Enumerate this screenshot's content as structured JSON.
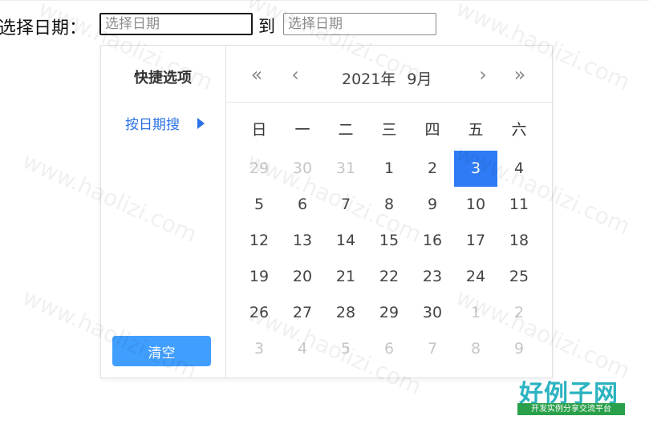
{
  "form": {
    "label": "选择日期：",
    "start_placeholder": "选择日期",
    "end_placeholder": "选择日期",
    "range_separator": "到"
  },
  "sidebar": {
    "title": "快捷选项",
    "shortcut": "按日期搜",
    "clear_button": "清空"
  },
  "calendar": {
    "year_label": "2021年",
    "month_label": "9月",
    "nav": {
      "prev_year": "«",
      "prev_month": "‹",
      "next_month": "›",
      "next_year": "»"
    },
    "weekdays": [
      "日",
      "一",
      "二",
      "三",
      "四",
      "五",
      "六"
    ],
    "days": [
      {
        "label": "29",
        "other": true
      },
      {
        "label": "30",
        "other": true
      },
      {
        "label": "31",
        "other": true
      },
      {
        "label": "1"
      },
      {
        "label": "2"
      },
      {
        "label": "3",
        "selected": true
      },
      {
        "label": "4"
      },
      {
        "label": "5"
      },
      {
        "label": "6"
      },
      {
        "label": "7"
      },
      {
        "label": "8"
      },
      {
        "label": "9"
      },
      {
        "label": "10"
      },
      {
        "label": "11"
      },
      {
        "label": "12"
      },
      {
        "label": "13"
      },
      {
        "label": "14"
      },
      {
        "label": "15"
      },
      {
        "label": "16"
      },
      {
        "label": "17"
      },
      {
        "label": "18"
      },
      {
        "label": "19"
      },
      {
        "label": "20"
      },
      {
        "label": "21"
      },
      {
        "label": "22"
      },
      {
        "label": "23"
      },
      {
        "label": "24"
      },
      {
        "label": "25"
      },
      {
        "label": "26"
      },
      {
        "label": "27"
      },
      {
        "label": "28"
      },
      {
        "label": "29"
      },
      {
        "label": "30"
      },
      {
        "label": "1",
        "other": true
      },
      {
        "label": "2",
        "other": true
      },
      {
        "label": "3",
        "other": true
      },
      {
        "label": "4",
        "other": true
      },
      {
        "label": "5",
        "other": true
      },
      {
        "label": "6",
        "other": true
      },
      {
        "label": "7",
        "other": true
      },
      {
        "label": "8",
        "other": true
      },
      {
        "label": "9",
        "other": true
      }
    ]
  },
  "watermark": {
    "text": "www.haolizi.com"
  },
  "brand": {
    "name": "好例子网",
    "tagline": "开发实例分享交流平台"
  },
  "colors": {
    "accent": "#409eff",
    "selected": "#2f7bf5",
    "link": "#2b72e6"
  }
}
